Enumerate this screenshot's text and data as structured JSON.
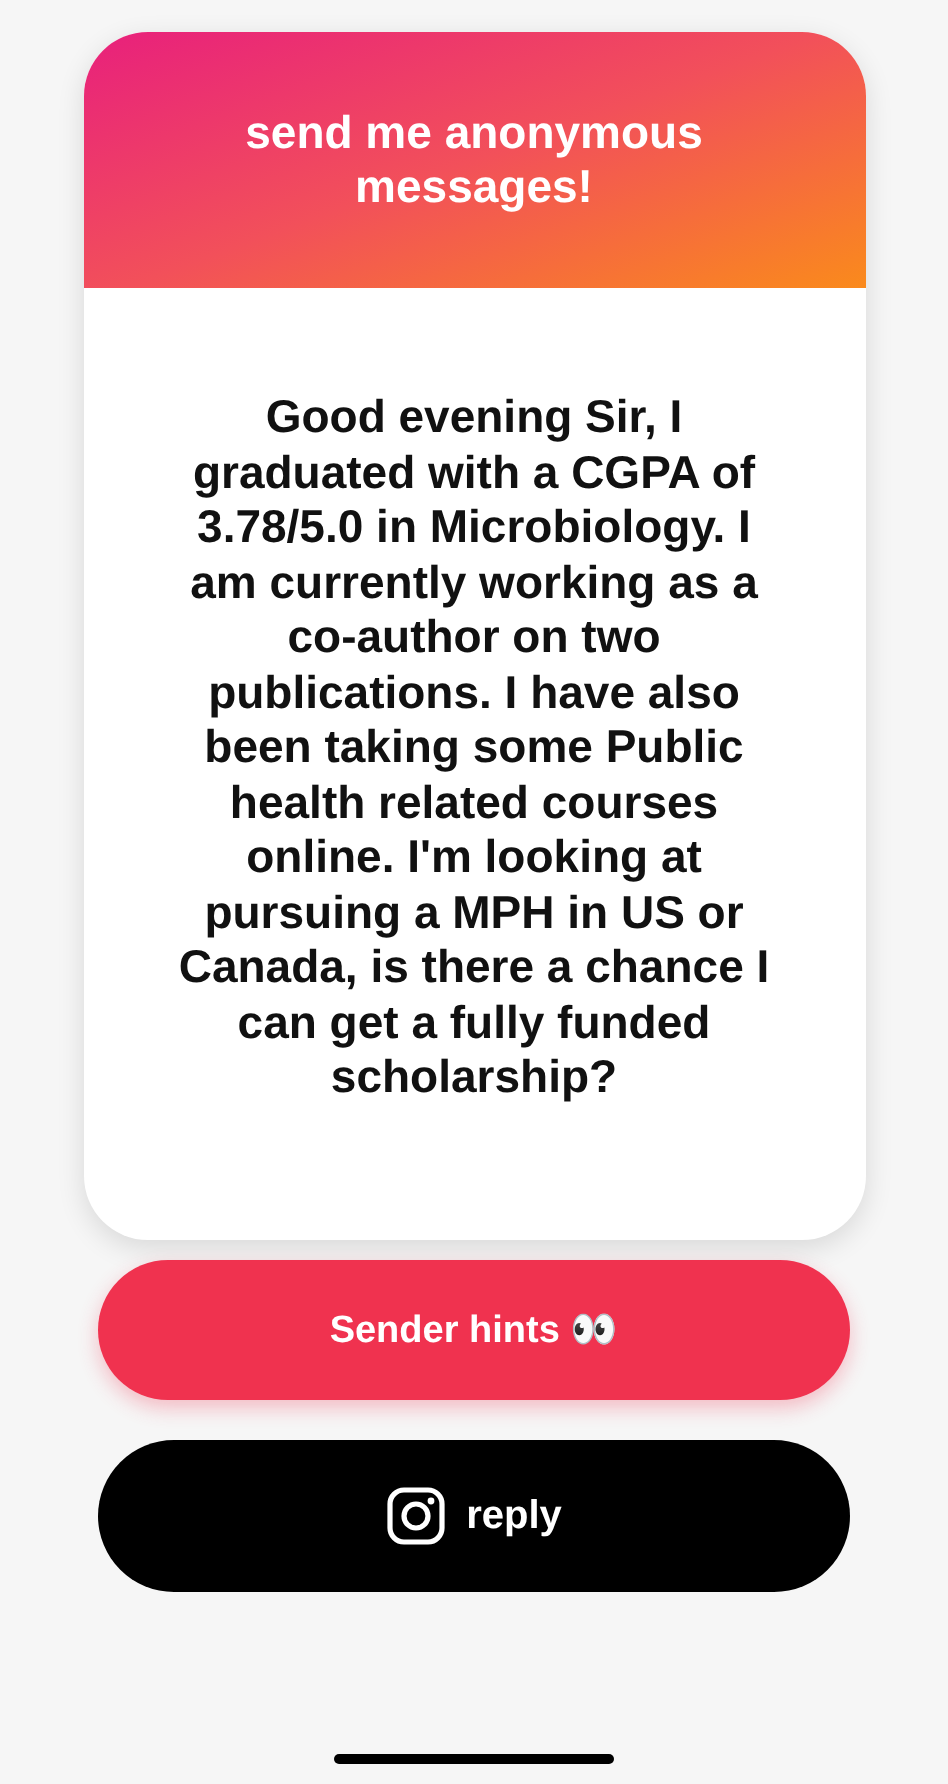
{
  "card": {
    "title": "send me anonymous messages!",
    "message": "Good evening Sir, I graduated with a CGPA of 3.78/5.0 in Microbiology. I am currently working as a co-author on two publications. I have also been taking some Public health related courses online. I'm looking at pursuing a MPH in US or Canada, is there a chance I can get a fully funded scholarship?"
  },
  "buttons": [
    {
      "kind": "hints",
      "label": "Sender hints 👀"
    },
    {
      "kind": "reply",
      "label": "reply"
    }
  ]
}
